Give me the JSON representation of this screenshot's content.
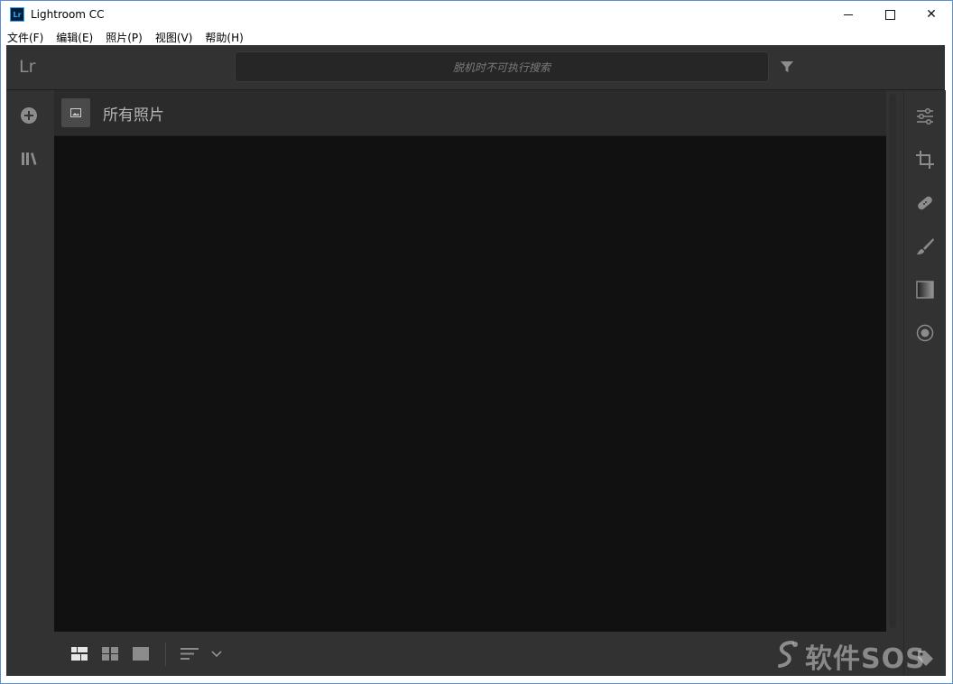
{
  "window": {
    "title": "Lightroom CC",
    "app_icon_text": "Lr",
    "controls": [
      "minimize",
      "maximize",
      "close"
    ],
    "close_glyph": "✕"
  },
  "menu": [
    {
      "label": "文件(F)"
    },
    {
      "label": "编辑(E)"
    },
    {
      "label": "照片(P)"
    },
    {
      "label": "视图(V)"
    },
    {
      "label": "帮助(H)"
    }
  ],
  "app": {
    "logo": "Lr",
    "search_placeholder": "脱机时不可执行搜索",
    "filter_icon": "filter-icon"
  },
  "left_rail": {
    "items": [
      {
        "icon": "add-photos-icon"
      },
      {
        "icon": "library-icon"
      }
    ]
  },
  "main": {
    "album_title": "所有照片",
    "album_icon": "image-icon"
  },
  "bottom_bar": {
    "view_modes": [
      "square-grid-view-icon",
      "photo-grid-view-icon",
      "detail-view-icon"
    ],
    "sort_icon": "sort-icon"
  },
  "right_rail": {
    "tools": [
      "edit-sliders-icon",
      "crop-icon",
      "healing-brush-icon",
      "brush-icon",
      "linear-gradient-icon",
      "radial-gradient-icon"
    ],
    "keyword_icon": "tag-icon"
  },
  "watermark": {
    "text": "软件SOS"
  },
  "colors": {
    "app_bg": "#323232",
    "grid_bg": "#111111",
    "icon": "#8c8c8c"
  }
}
